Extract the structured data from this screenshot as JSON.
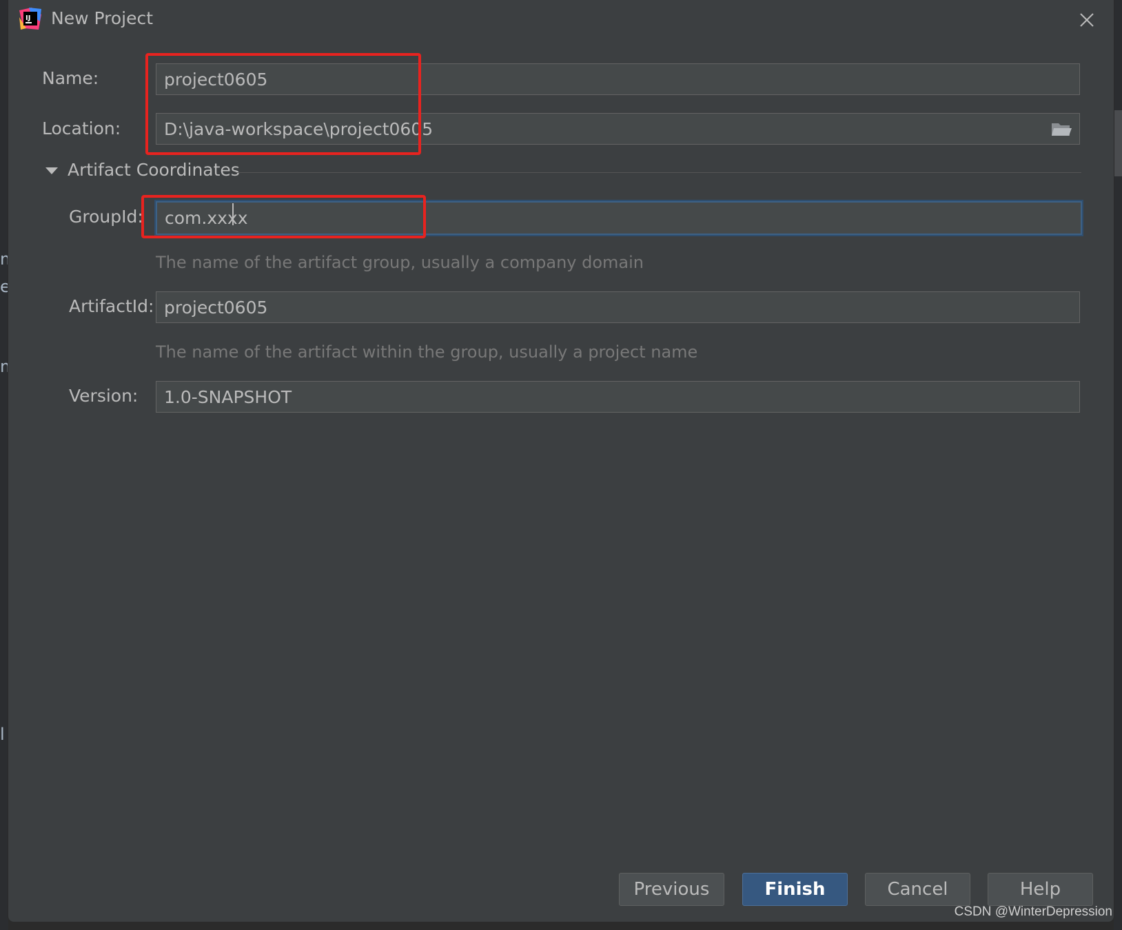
{
  "dialog": {
    "title": "New Project",
    "app_icon": "intellij-idea-icon",
    "close_icon": "close-icon"
  },
  "form": {
    "name_label": "Name:",
    "name_value": "project0605",
    "location_label": "Location:",
    "location_value": "D:\\java-workspace\\project0605",
    "browse_icon": "folder-icon",
    "section_title": "Artifact Coordinates",
    "groupid_label": "GroupId:",
    "groupid_value": "com.xxxx",
    "groupid_hint": "The name of the artifact group, usually a company domain",
    "artifactid_label": "ArtifactId:",
    "artifactid_value": "project0605",
    "artifactid_hint": "The name of the artifact within the group, usually a project name",
    "version_label": "Version:",
    "version_value": "1.0-SNAPSHOT"
  },
  "buttons": {
    "previous": "Previous",
    "finish": "Finish",
    "cancel": "Cancel",
    "help": "Help"
  },
  "backdrop": {
    "glyphs": [
      "m",
      "e",
      "m",
      "l"
    ]
  },
  "watermark": "CSDN @WinterDepression",
  "colors": {
    "dialog_bg": "#3c3f41",
    "field_bg": "#45494a",
    "focus_border": "#3d6185",
    "primary_button": "#365880",
    "annotation_red": "#e8231f"
  }
}
